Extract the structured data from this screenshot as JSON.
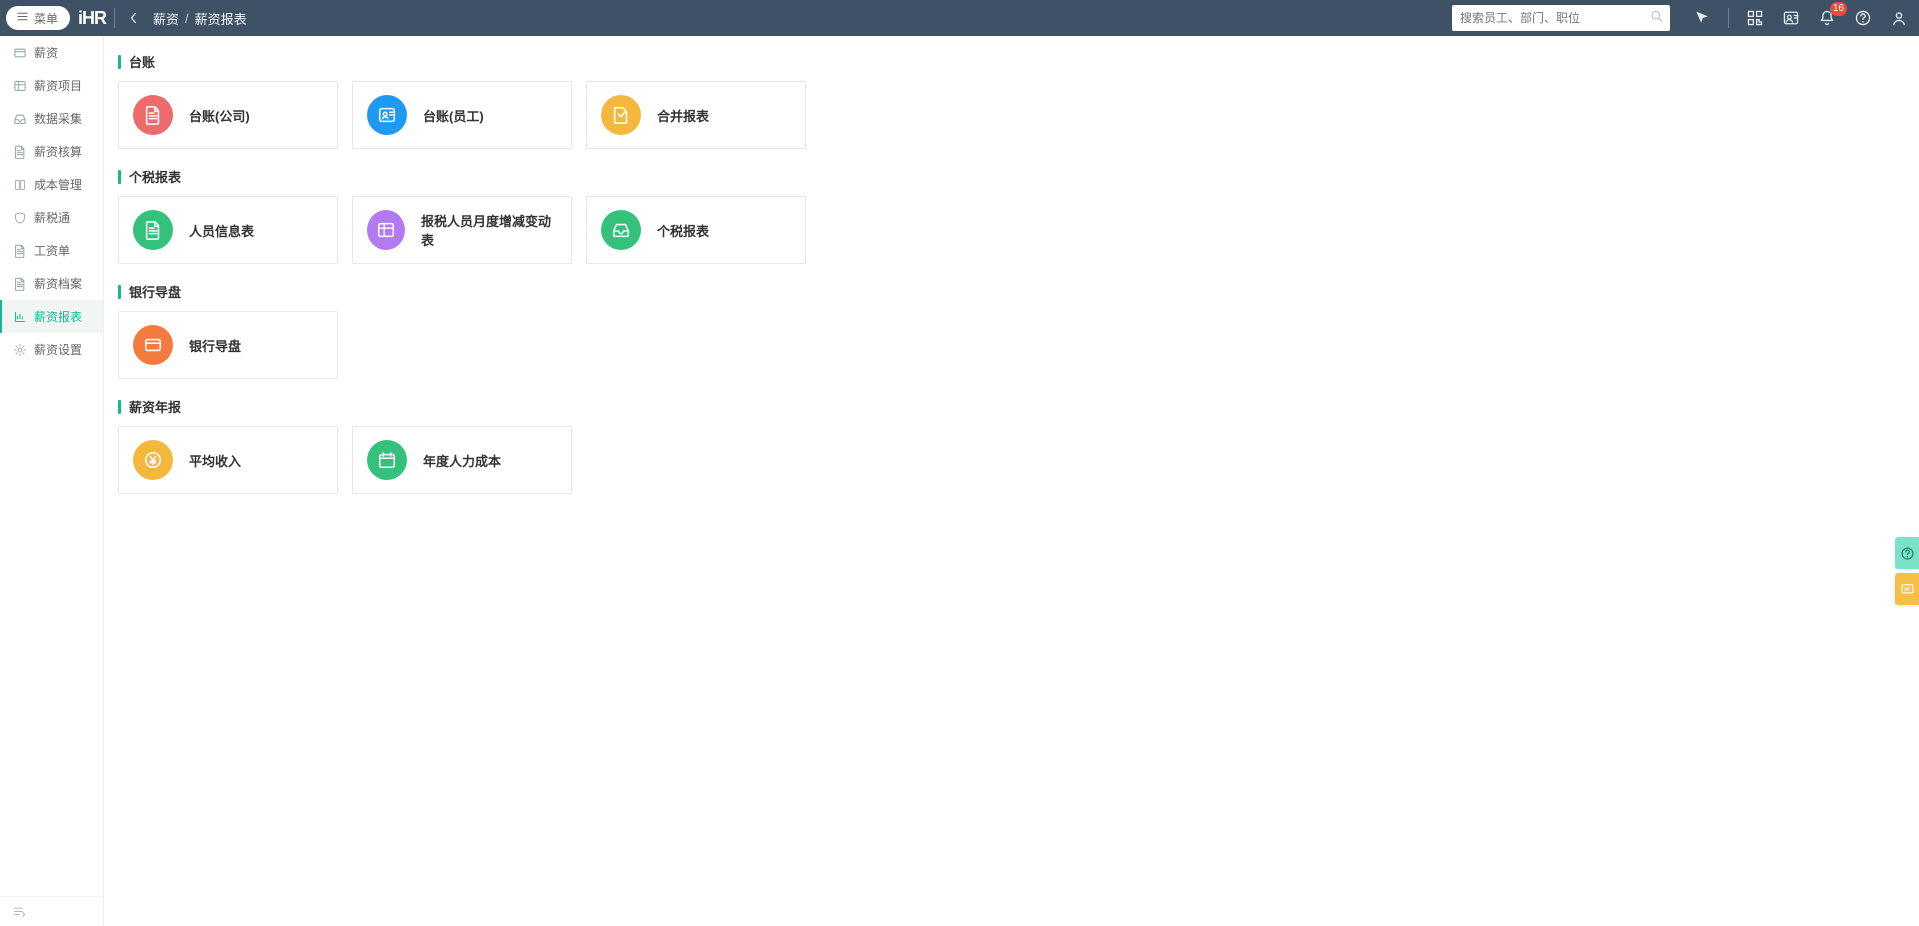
{
  "header": {
    "menu_label": "菜单",
    "logo_text": "iHR",
    "breadcrumb_root": "薪资",
    "breadcrumb_sep": "/",
    "breadcrumb_current": "薪资报表",
    "search_placeholder": "搜索员工、部门、职位",
    "notification_count": "16"
  },
  "sidebar": {
    "items": [
      {
        "label": "薪资",
        "icon": "wallet-icon",
        "active": false
      },
      {
        "label": "薪资项目",
        "icon": "list-icon",
        "active": false
      },
      {
        "label": "数据采集",
        "icon": "collect-icon",
        "active": false
      },
      {
        "label": "薪资核算",
        "icon": "calc-icon",
        "active": false
      },
      {
        "label": "成本管理",
        "icon": "book-icon",
        "active": false
      },
      {
        "label": "薪税通",
        "icon": "shield-icon",
        "active": false
      },
      {
        "label": "工资单",
        "icon": "receipt-icon",
        "active": false
      },
      {
        "label": "薪资档案",
        "icon": "folder-icon",
        "active": false
      },
      {
        "label": "薪资报表",
        "icon": "chart-icon",
        "active": true
      },
      {
        "label": "薪资设置",
        "icon": "gear-icon",
        "active": false
      }
    ]
  },
  "sections": [
    {
      "title": "台账",
      "cards": [
        {
          "label": "台账(公司)",
          "color": "#ef6a6a",
          "icon": "doc-icon"
        },
        {
          "label": "台账(员工)",
          "color": "#1e9bf0",
          "icon": "id-icon"
        },
        {
          "label": "合并报表",
          "color": "#f6b83c",
          "icon": "merge-doc-icon"
        }
      ]
    },
    {
      "title": "个税报表",
      "cards": [
        {
          "label": "人员信息表",
          "color": "#33c17c",
          "icon": "doc-icon"
        },
        {
          "label": "报税人员月度增减变动表",
          "color": "#b37bf2",
          "icon": "table-icon"
        },
        {
          "label": "个税报表",
          "color": "#33c17c",
          "icon": "inbox-icon"
        }
      ]
    },
    {
      "title": "银行导盘",
      "cards": [
        {
          "label": "银行导盘",
          "color": "#f37b3e",
          "icon": "card-icon"
        }
      ]
    },
    {
      "title": "薪资年报",
      "cards": [
        {
          "label": "平均收入",
          "color": "#f6b83c",
          "icon": "yen-icon"
        },
        {
          "label": "年度人力成本",
          "color": "#33c17c",
          "icon": "calendar-icon"
        }
      ]
    }
  ],
  "colors": {
    "accent": "#17b794",
    "topbar": "#3f5265"
  }
}
